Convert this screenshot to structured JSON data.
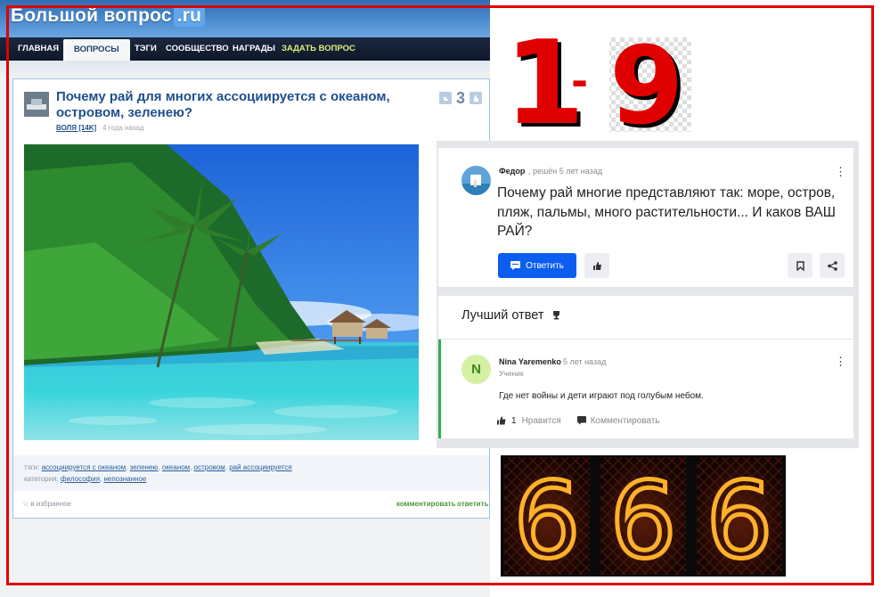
{
  "site": {
    "logo_text": "Большой вопрос",
    "logo_suffix": ".ru",
    "nav": [
      {
        "label": "Главная",
        "active": false
      },
      {
        "label": "Вопросы",
        "active": true
      },
      {
        "label": "Тэги",
        "active": false
      },
      {
        "label": "Сообщество",
        "active": false
      },
      {
        "label": "Награды",
        "active": false
      },
      {
        "label": "Задать вопрос",
        "active": false
      }
    ]
  },
  "question_card": {
    "title": "Почему рай для многих ассоциируется с океаном, островом, зеленею?",
    "author": "ВОЛЯ [14K]",
    "time": "4 года назад",
    "votes": "3",
    "tags_label": "тэги:",
    "tags": [
      "ассоциируется с океаном",
      "зеленею",
      "океаном",
      "островом",
      "рай ассоциируется"
    ],
    "category_label": "категория:",
    "categories": [
      "философия",
      "непознанное"
    ],
    "favorite": "☆ в избранное",
    "comment_link": "комментировать",
    "answer_link": "ответить"
  },
  "graphic_19": {
    "text_left": "1",
    "dash": "-",
    "text_right": "9",
    "color": "#e00000"
  },
  "qa": {
    "asker_name": "Федор",
    "asker_meta": ", решён 5 лет назад",
    "question": "Почему рай многие представляют так: море, остров, пляж, пальмы, много растительности... И каков ВАШ РАЙ?",
    "answer_button": "Ответить",
    "best_title": "Лучший ответ",
    "answerer_initial": "N",
    "answerer_name": "Nina Yaremenko",
    "answer_time": ", 5 лет назад",
    "answerer_role": "Ученик",
    "answer_text": "Где нет войны и дети играют под голубым небом.",
    "likes": "1",
    "like_label": "Нравится",
    "comment_label": "Комментировать",
    "accent": "#0b5eef",
    "best_bar_color": "#2eb24a"
  },
  "nixie": {
    "digits": [
      "6",
      "6",
      "6"
    ],
    "glow_color": "#ff5a1a"
  }
}
